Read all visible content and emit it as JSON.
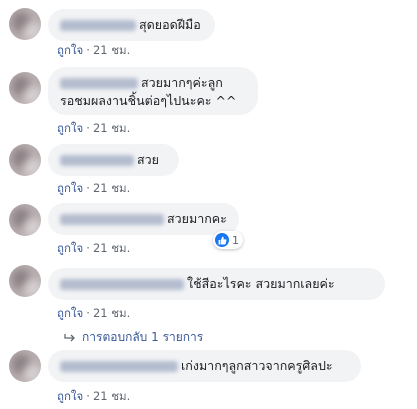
{
  "comments": [
    {
      "text": "สุดยอดฝีมือ",
      "action": "ถูกใจ",
      "time": "21 ชม."
    },
    {
      "text_line1": "สวยมากๆค่ะลูก",
      "text_line2": "รอชมผลงานชิ้นต่อๆไปนะคะ ^^",
      "action": "ถูกใจ",
      "time": "21 ชม."
    },
    {
      "text": "สวย",
      "action": "ถูกใจ",
      "time": "21 ชม."
    },
    {
      "text": "สวยมากคะ",
      "action": "ถูกใจ",
      "time": "21 ชม.",
      "reaction_count": "1"
    },
    {
      "text": "ใช้สีอะไรคะ สวยมากเลยค่ะ",
      "action": "ถูกใจ",
      "time": "21 ชม.",
      "replies_label": "การตอบกลับ 1 รายการ"
    },
    {
      "text": "เก่งมากๆลูกสาวจากครูศิลปะ",
      "action": "ถูกใจ",
      "time": "21 ชม."
    }
  ],
  "meta_separator": "·",
  "colors": {
    "bubble": "#f2f3f5",
    "link": "#385898",
    "reaction_blue": "#1877f2",
    "meta_gray": "#606770"
  },
  "icons": [
    "like-icon",
    "reply-arrow-icon"
  ]
}
